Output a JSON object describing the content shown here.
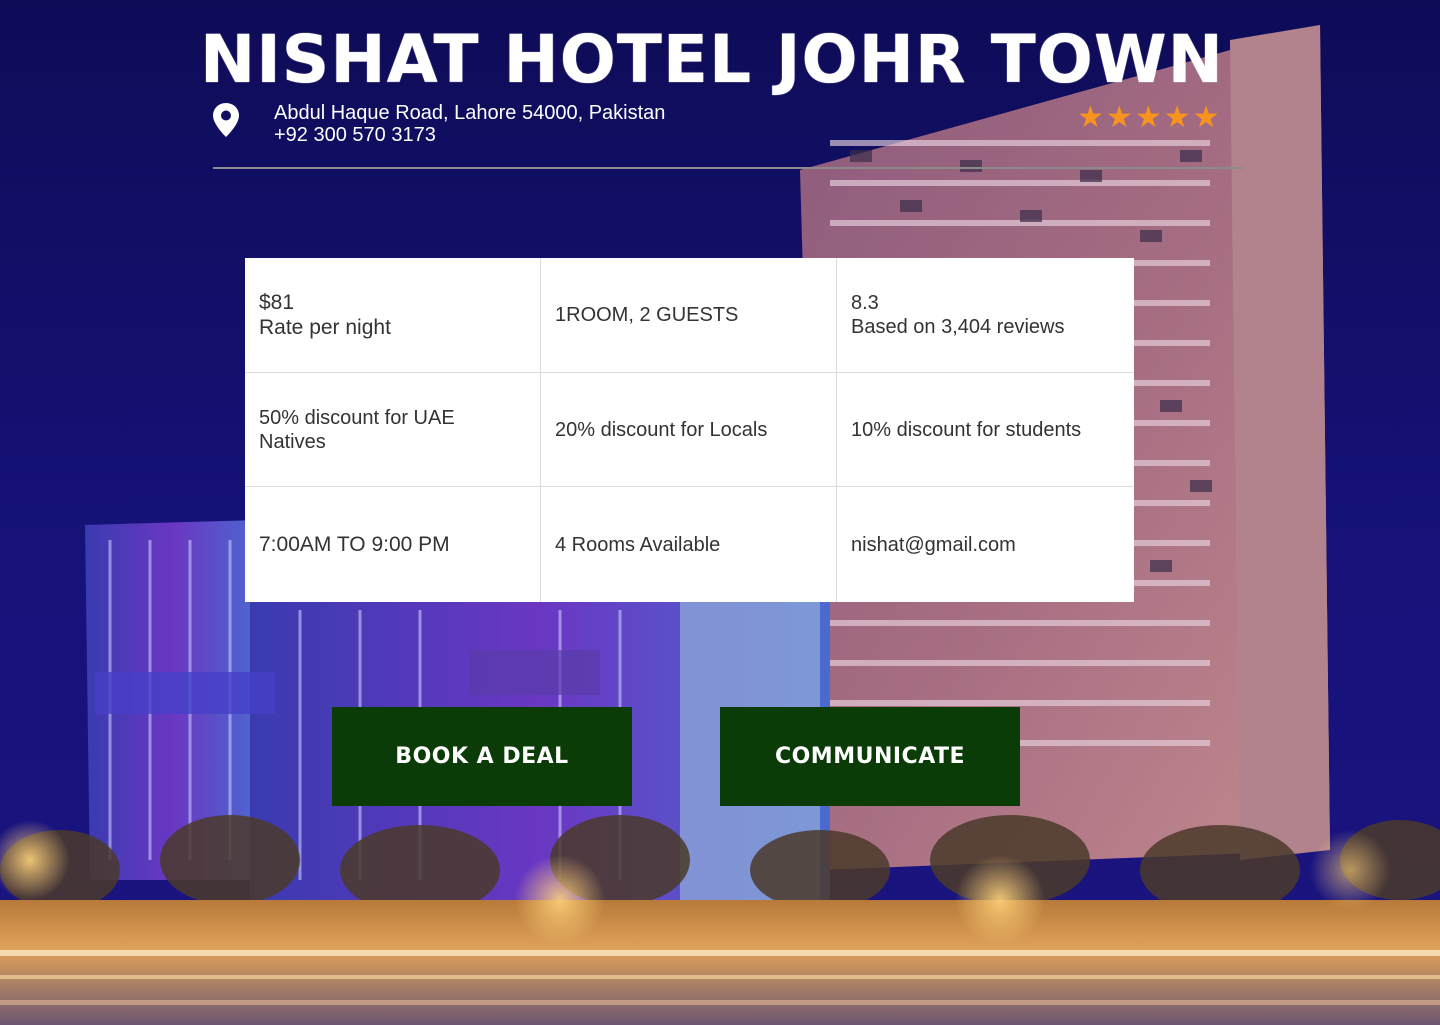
{
  "header": {
    "title": "NISHAT HOTEL JOHR TOWN",
    "address": "Abdul Haque Road, Lahore 54000, Pakistan",
    "phone": "+92 300 570 3173",
    "star_rating": 5
  },
  "info": {
    "rate": {
      "amount": "$81",
      "label": "Rate per night"
    },
    "occupancy": "1ROOM, 2 GUESTS",
    "rating": {
      "score": "8.3",
      "reviews": "Based on 3,404 reviews"
    },
    "discounts": {
      "uae": "50% discount for UAE Natives",
      "locals": "20% discount for Locals",
      "students": "10% discount for students"
    },
    "hours": "7:00AM TO 9:00 PM",
    "availability": "4 Rooms Available",
    "email": "nishat@gmail.com"
  },
  "actions": {
    "book_label": "BOOK A DEAL",
    "communicate_label": "COMMUNICATE"
  },
  "colors": {
    "star": "#f7931e",
    "button_bg": "#0b3b06",
    "night_sky": "#120f5c"
  },
  "icons": {
    "location": "map-pin-icon",
    "rating": "star-icon"
  }
}
